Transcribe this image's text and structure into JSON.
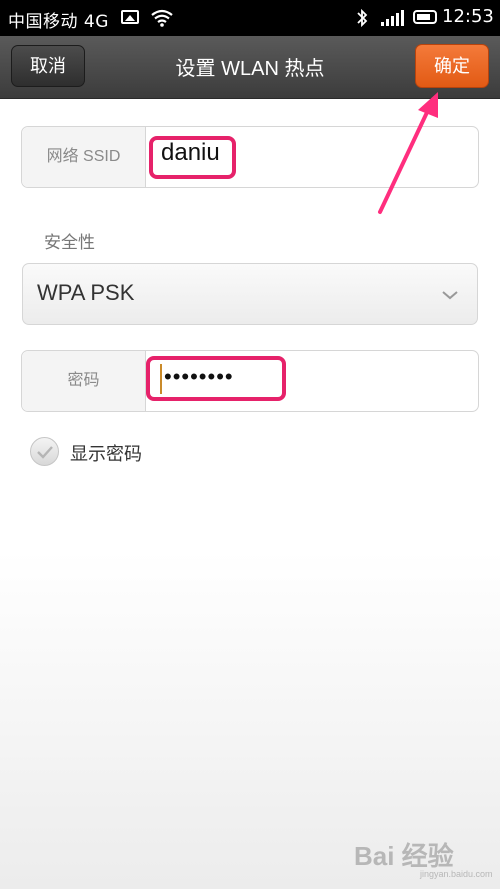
{
  "status_bar": {
    "carrier": "中国移动 4G",
    "time": "12:53",
    "icons": [
      "image-icon",
      "wifi-icon",
      "bluetooth-icon",
      "signal-icon",
      "battery-icon"
    ]
  },
  "action_bar": {
    "cancel_label": "取消",
    "title": "设置 WLAN 热点",
    "ok_label": "确定"
  },
  "form": {
    "ssid_label": "网络 SSID",
    "ssid_value": "daniu",
    "security_label": "安全性",
    "security_value": "WPA PSK",
    "password_label": "密码",
    "password_value": "••••••••",
    "show_password_label": "显示密码",
    "show_password_checked": true
  },
  "annotation": {
    "highlight_color": "#e6226a",
    "arrow_color": "#ff2e7e"
  },
  "colors": {
    "ok_button": "#e25a14",
    "action_bar": "#4a4a4a"
  },
  "watermark": {
    "text": "Bai 经验",
    "sub": "jingyan.baidu.com"
  }
}
